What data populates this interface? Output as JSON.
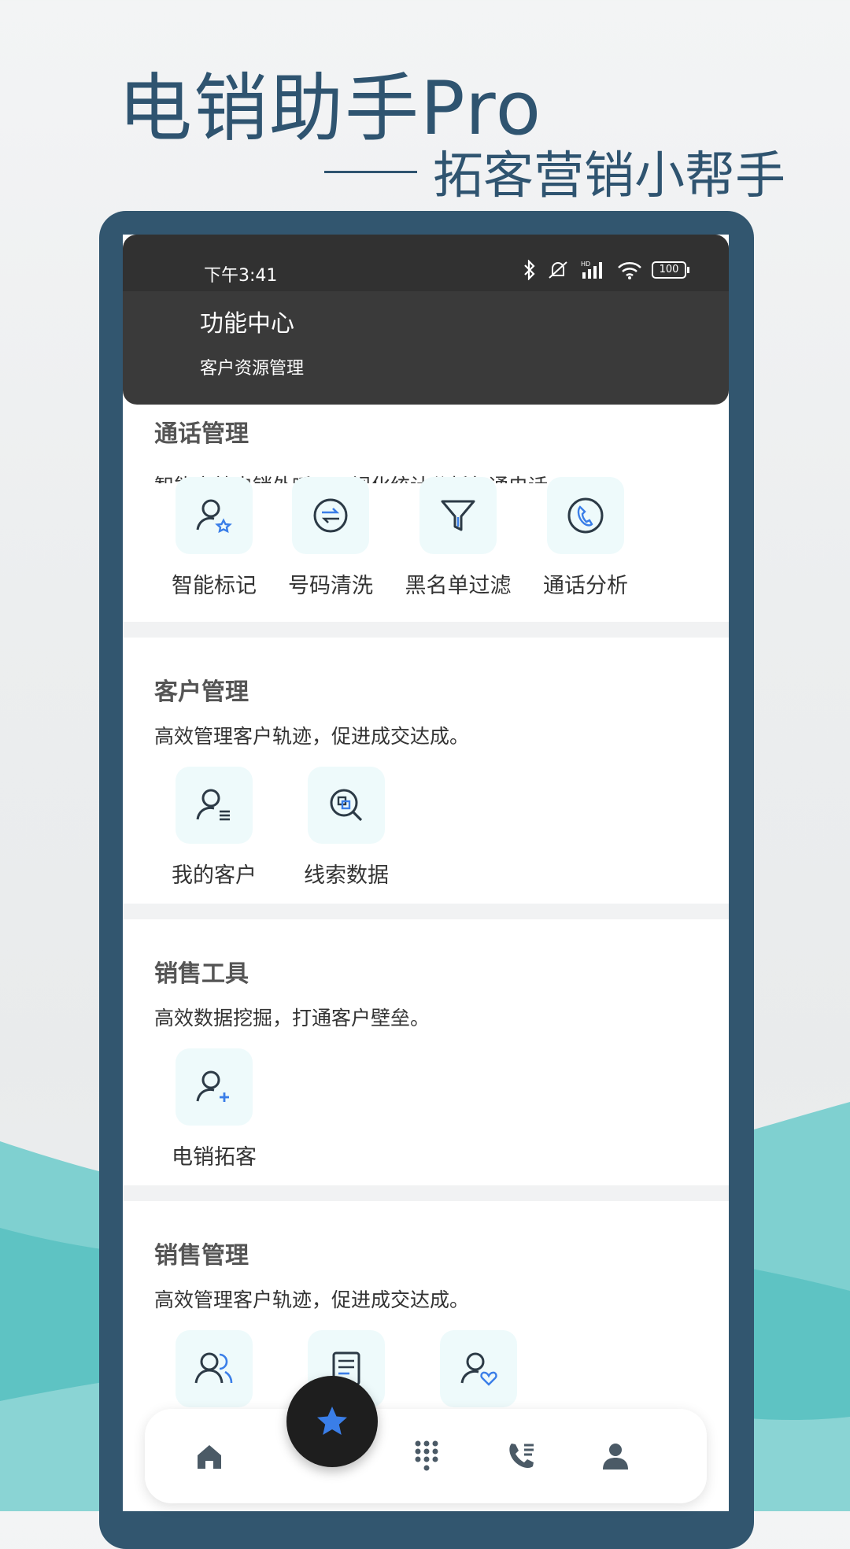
{
  "promo": {
    "headline": "电销助手Pro",
    "tagline": "拓客营销小帮手"
  },
  "status_bar": {
    "time": "下午3:41",
    "battery": "100",
    "icons": [
      "bluetooth-icon",
      "mute-icon",
      "signal-icon",
      "wifi-icon",
      "battery-icon"
    ]
  },
  "header": {
    "title": "功能中心",
    "subtitle": "客户资源管理"
  },
  "sections": [
    {
      "title": "通话管理",
      "desc": "智能高效电销外呼，可视化统计分析每通电话。",
      "tools": [
        {
          "label": "智能标记",
          "icon": "user-star-icon"
        },
        {
          "label": "号码清洗",
          "icon": "swap-circle-icon"
        },
        {
          "label": "黑名单过滤",
          "icon": "filter-icon"
        },
        {
          "label": "通话分析",
          "icon": "phone-circle-icon"
        }
      ]
    },
    {
      "title": "客户管理",
      "desc": "高效管理客户轨迹，促进成交达成。",
      "tools": [
        {
          "label": "我的客户",
          "icon": "user-list-icon"
        },
        {
          "label": "线索数据",
          "icon": "search-data-icon"
        }
      ]
    },
    {
      "title": "销售工具",
      "desc": "高效数据挖掘，打通客户壁垒。",
      "tools": [
        {
          "label": "电销拓客",
          "icon": "user-add-icon"
        }
      ]
    },
    {
      "title": "销售管理",
      "desc": "高效管理客户轨迹，促进成交达成。",
      "tools": [
        {
          "label": "",
          "icon": "users-icon"
        },
        {
          "label": "",
          "icon": "document-icon"
        },
        {
          "label": "",
          "icon": "user-heart-icon"
        }
      ]
    }
  ],
  "bottom_nav": {
    "items": [
      "home-icon",
      "star-icon",
      "dialpad-icon",
      "call-log-icon",
      "profile-icon"
    ],
    "active": "star-icon"
  },
  "colors": {
    "frame": "#32566f",
    "header": "#3a3a3a",
    "tile_bg": "#eefafb",
    "accent": "#3a7ee8",
    "teal": "#5cc6c6"
  }
}
